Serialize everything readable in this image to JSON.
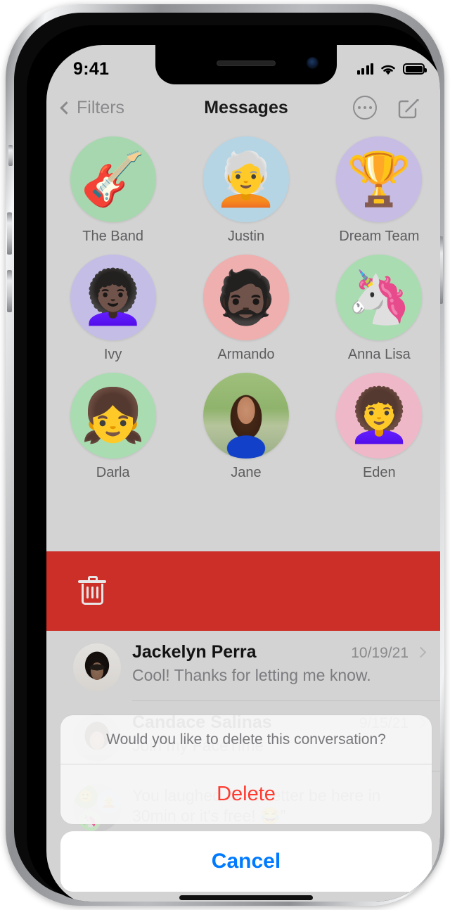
{
  "device": {
    "status_bar": {
      "time": "9:41",
      "signal_icon": "cellular-bars-icon",
      "wifi_icon": "wifi-icon",
      "battery_icon": "battery-full-icon"
    },
    "home_indicator": "home-indicator"
  },
  "nav": {
    "back_label": "Filters",
    "back_icon": "chevron-left-icon",
    "title": "Messages",
    "more_icon": "ellipsis-circle-icon",
    "compose_icon": "compose-icon"
  },
  "pinned": {
    "rows": [
      [
        {
          "name": "The Band",
          "glyph": "🎸",
          "bg": "#a7d7ae",
          "kind": "emoji"
        },
        {
          "name": "Justin",
          "glyph": "🧑‍🦳",
          "bg": "#b6d5e4",
          "kind": "memoji"
        },
        {
          "name": "Dream Team",
          "glyph": "🏆",
          "bg": "#c7bce4",
          "kind": "emoji"
        }
      ],
      [
        {
          "name": "Ivy",
          "glyph": "👩🏿‍🦱",
          "bg": "#c4bde6",
          "kind": "memoji"
        },
        {
          "name": "Armando",
          "glyph": "🧔🏿",
          "bg": "#eeafae",
          "kind": "memoji"
        },
        {
          "name": "Anna Lisa",
          "glyph": "🦄",
          "bg": "#a9dcb0",
          "kind": "memoji"
        }
      ],
      [
        {
          "name": "Darla",
          "glyph": "👧",
          "bg": "#a9dcb0",
          "kind": "memoji"
        },
        {
          "name": "Jane",
          "glyph": "",
          "bg": "#dcdcdc",
          "kind": "photo-jane"
        },
        {
          "name": "Eden",
          "glyph": "👩‍🦱",
          "bg": "#efb8c8",
          "kind": "memoji"
        }
      ]
    ]
  },
  "swipe_action": {
    "icon": "trash-icon",
    "color": "#cc2e28",
    "label": ""
  },
  "conversations": [
    {
      "name": "Jackelyn Perra",
      "date": "10/19/21",
      "snippet": "Cool! Thanks for letting me know.",
      "avatar_kind": "photo-jack",
      "chevron": "chevron-right-icon"
    },
    {
      "name": "Candace Salinas",
      "date": "9/15/21",
      "snippet": "Join my FaceTime",
      "avatar_kind": "photo-candace",
      "chevron": "chevron-right-icon"
    },
    {
      "name": "",
      "date": "",
      "snippet": "You laughed at “It better be here in 30min or it's free! 😂”",
      "avatar_kind": "group",
      "chevron": ""
    }
  ],
  "action_sheet": {
    "message": "Would you like to delete this conversation?",
    "delete_label": "Delete",
    "delete_color": "#ff3b30",
    "cancel_label": "Cancel",
    "cancel_color": "#007aff"
  }
}
